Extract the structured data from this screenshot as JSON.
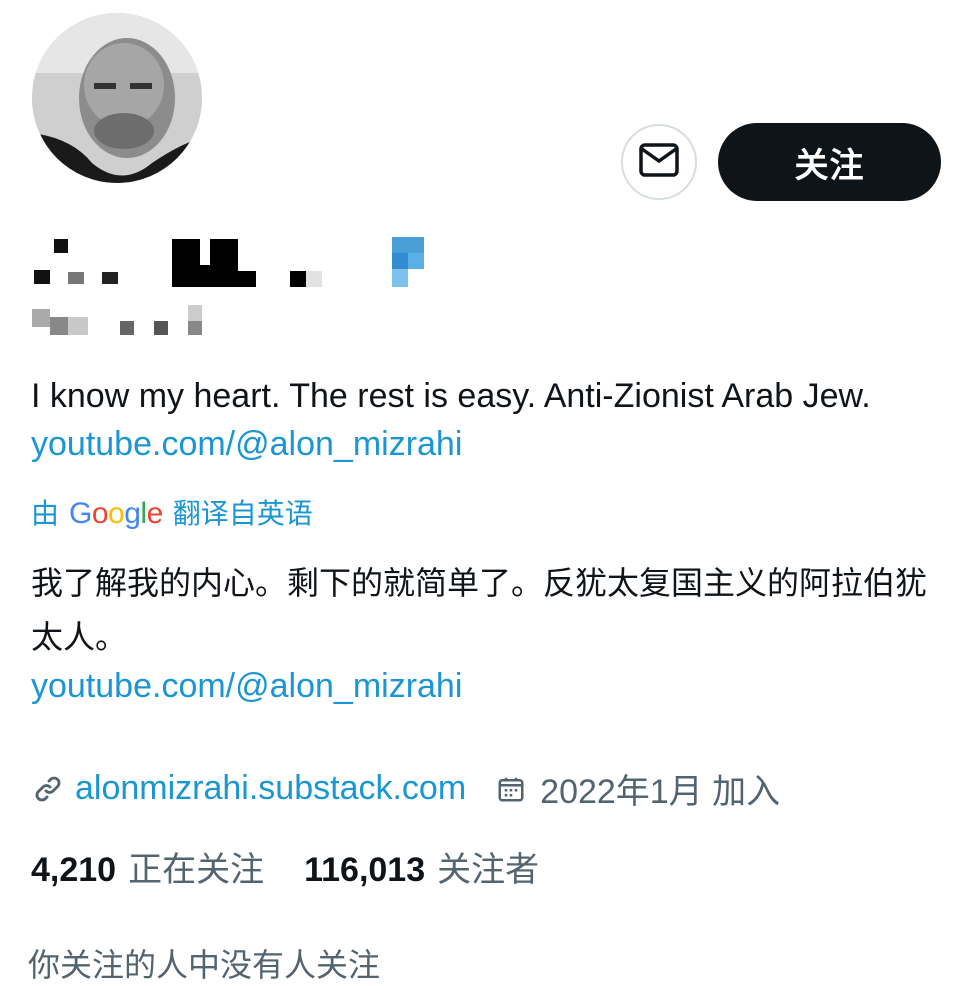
{
  "profile": {
    "follow_label": "关注",
    "bio_en_text": "I know my heart. The rest is easy. Anti-Zionist Arab Jew.",
    "bio_en_link": "youtube.com/@alon_mizrahi",
    "translated_prefix": "由",
    "translated_brand": "Google",
    "translated_suffix": "翻译自英语",
    "bio_zh_text": "我了解我的内心。剩下的就简单了。反犹太复国主义的阿拉伯犹太人。",
    "bio_zh_link": "youtube.com/@alon_mizrahi",
    "website": "alonmizrahi.substack.com",
    "joined": "2022年1月 加入",
    "following_count": "4,210",
    "following_label": "正在关注",
    "followers_count": "116,013",
    "followers_label": "关注者",
    "footnote": "你关注的人中没有人关注"
  },
  "icons": [
    "mail-icon",
    "link-icon",
    "calendar-icon"
  ],
  "colors": {
    "link": "#1b96d4",
    "button": "#0f1419",
    "secondary": "#536471"
  }
}
